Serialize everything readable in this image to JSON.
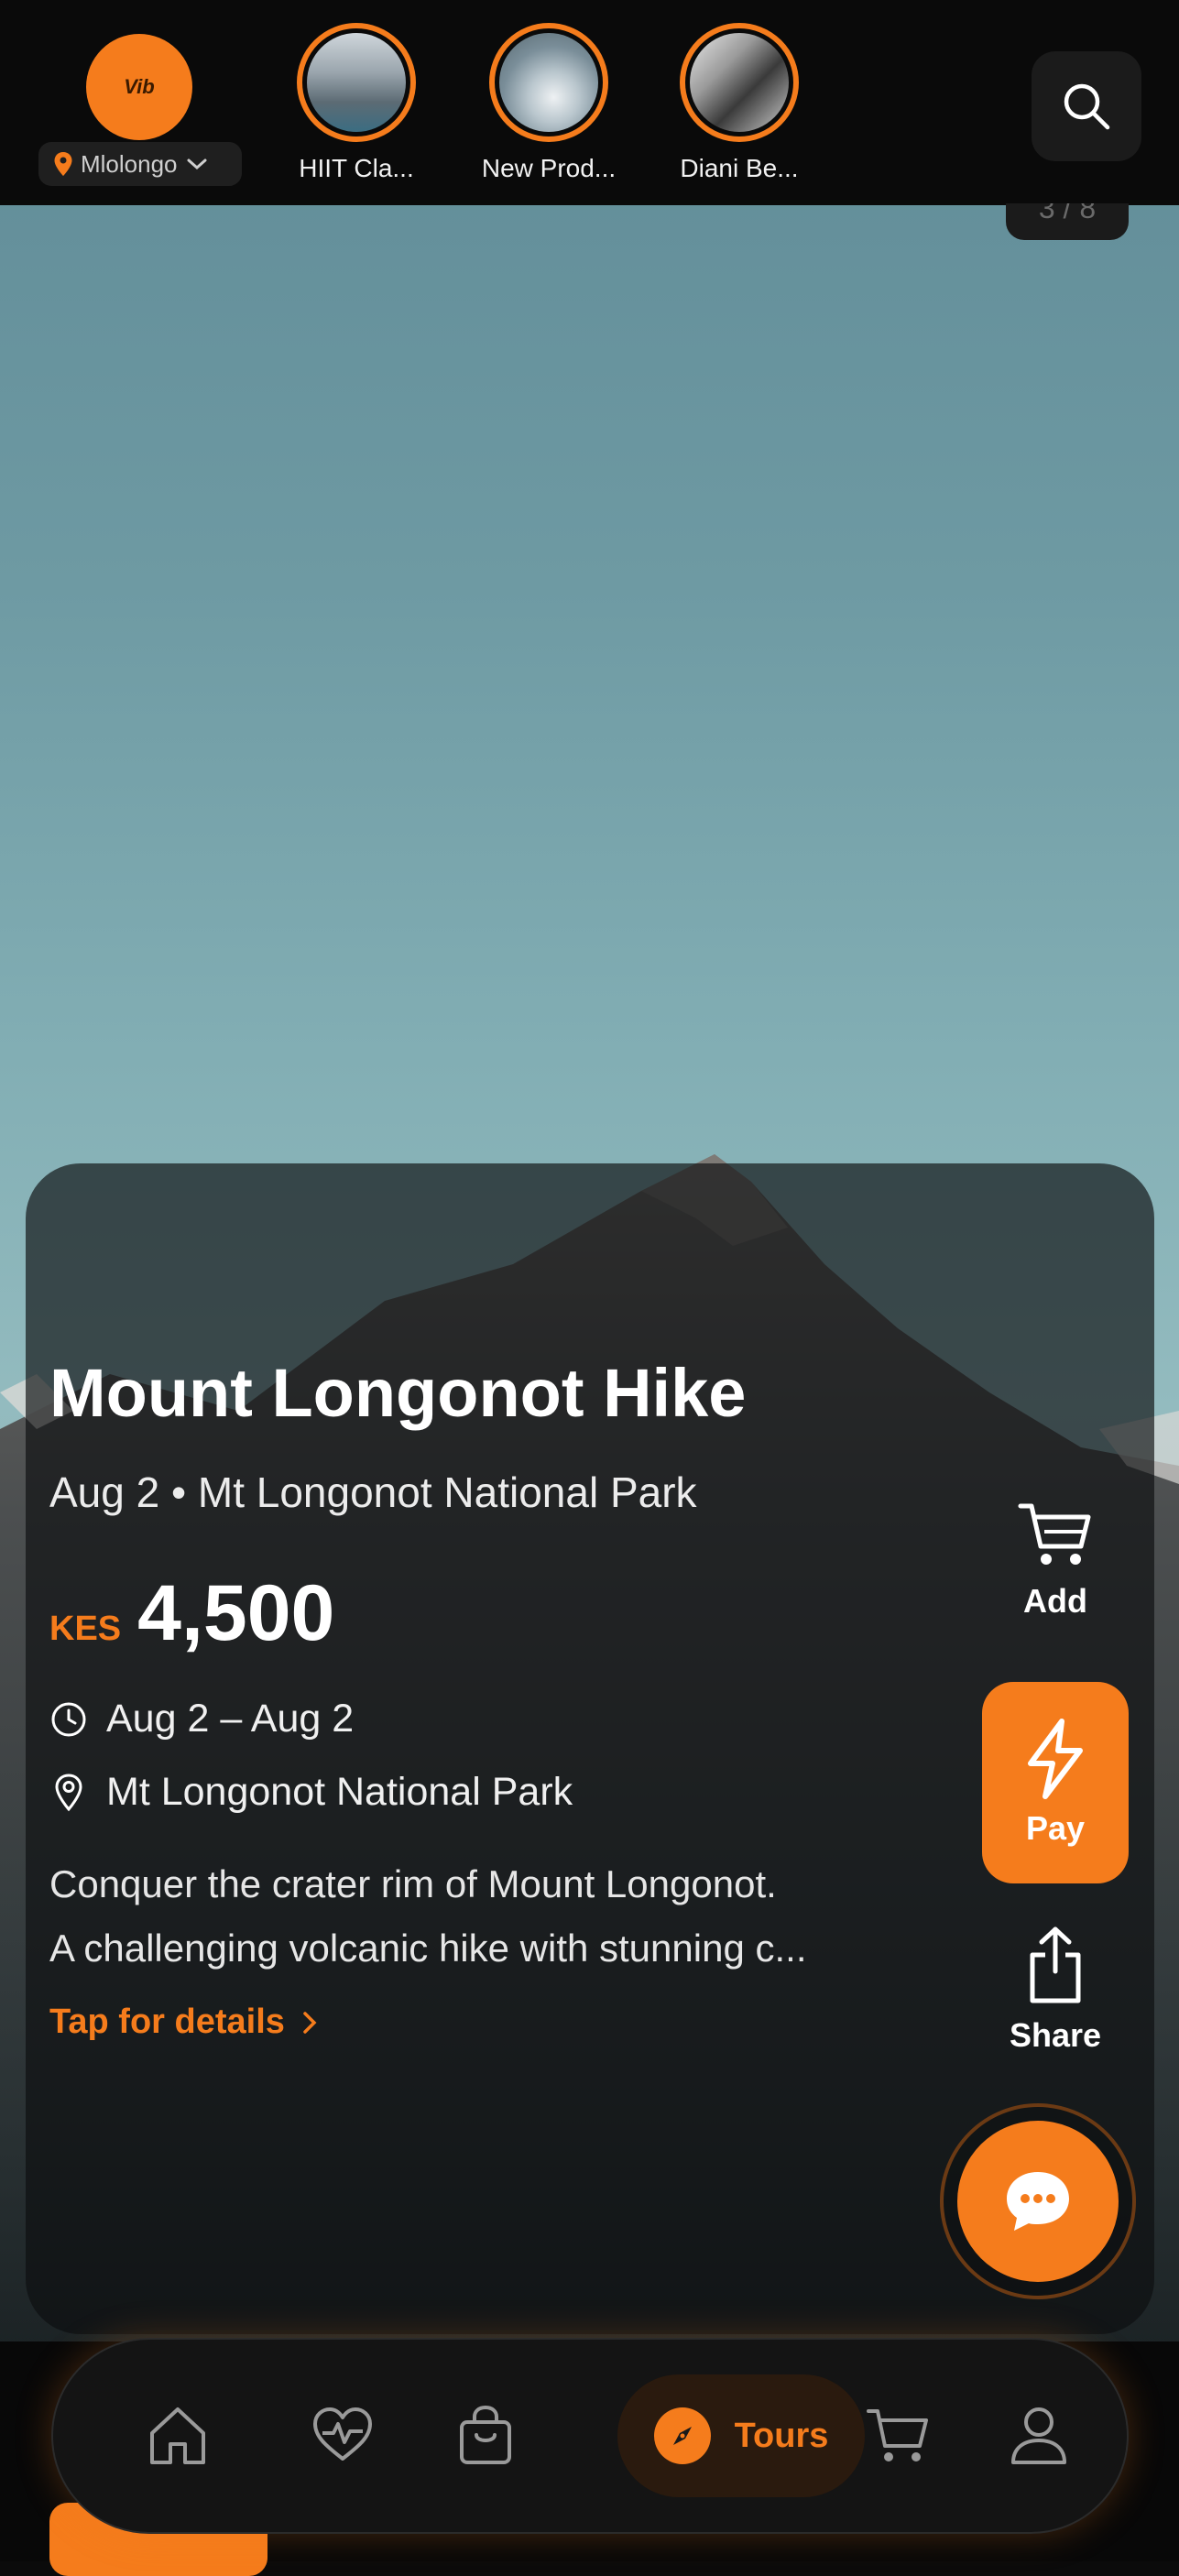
{
  "header": {
    "brand": {
      "logo_text": "Vib"
    },
    "location": {
      "label": "Mlolongo"
    },
    "stories": [
      {
        "label": "HIIT Cla..."
      },
      {
        "label": "New Prod..."
      },
      {
        "label": "Diani Be..."
      }
    ],
    "counter": "3 / 8"
  },
  "event": {
    "title": "Mount Longonot Hike",
    "subtitle": "Aug 2 • Mt Longonot National Park",
    "price": {
      "currency": "KES",
      "amount": "4,500"
    },
    "dates": "Aug 2 – Aug 2",
    "venue": "Mt Longonot National Park",
    "description": [
      "Conquer the crater rim of Mount Longonot.",
      "A challenging volcanic hike with stunning c..."
    ],
    "details_link": "Tap for details"
  },
  "actions": {
    "add": "Add",
    "pay": "Pay",
    "share": "Share"
  },
  "nav": {
    "active": "Tours"
  },
  "colors": {
    "accent": "#f57c1c",
    "background": "#0a0a0a"
  }
}
